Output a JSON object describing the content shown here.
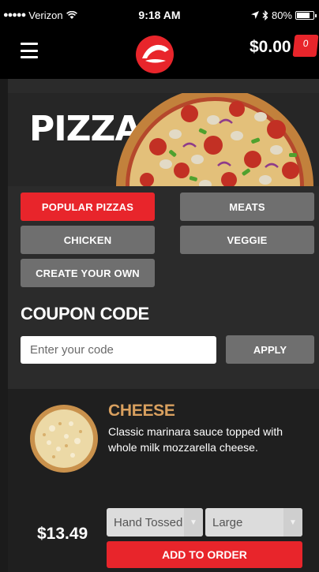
{
  "status_bar": {
    "carrier": "Verizon",
    "time": "9:18 AM",
    "battery": "80%",
    "battery_level": 0.8
  },
  "header": {
    "menu_icon": "hamburger-menu-icon",
    "logo_icon": "pizza-hut-logo",
    "cart_total": "$0.00",
    "cart_count": "0"
  },
  "hero": {
    "title": "PIZZA"
  },
  "categories": [
    {
      "label": "POPULAR PIZZAS",
      "active": true
    },
    {
      "label": "MEATS",
      "active": false
    },
    {
      "label": "CHICKEN",
      "active": false
    },
    {
      "label": "VEGGIE",
      "active": false
    },
    {
      "label": "CREATE YOUR OWN",
      "active": false
    }
  ],
  "coupon": {
    "title": "COUPON CODE",
    "placeholder": "Enter your code",
    "value": "",
    "apply_label": "APPLY"
  },
  "product": {
    "name": "CHEESE",
    "description": "Classic marinara sauce topped with whole milk mozzarella cheese.",
    "price": "$13.49",
    "crust_value": "Hand Tossed",
    "size_value": "Large",
    "add_label": "ADD TO ORDER"
  },
  "colors": {
    "brand_red": "#e8252b",
    "button_grey": "#6f6f6f",
    "product_name_gold": "#d9a05f"
  }
}
